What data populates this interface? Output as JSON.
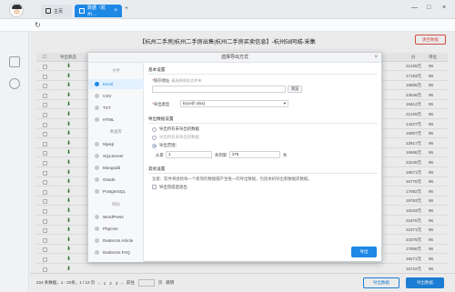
{
  "tabs": {
    "home_label": "主页",
    "active_label": "数据（杭州…",
    "add_symbol": "+",
    "close_symbol": "×"
  },
  "window": {
    "minimize": "—",
    "maximize": "□",
    "close": "×"
  },
  "page": {
    "title": "【杭州二手房|杭州二手房出售|杭州二手房买卖信息】-杭州58同城-采集",
    "delete_button": "清空数据"
  },
  "table": {
    "header_label": "导出状态",
    "header_right1": "价",
    "header_right2": "单位",
    "rows": [
      {
        "num": "21228元",
        "num2": "96"
      },
      {
        "num": "17183元",
        "num2": "96"
      },
      {
        "num": "15855元",
        "num2": "96"
      },
      {
        "num": "23548元",
        "num2": "96"
      },
      {
        "num": "16612元",
        "num2": "96"
      },
      {
        "num": "21229元",
        "num2": "96"
      },
      {
        "num": "14227元",
        "num2": "96"
      },
      {
        "num": "15807元",
        "num2": "96"
      },
      {
        "num": "22817元",
        "num2": "96"
      },
      {
        "num": "16666元",
        "num2": "96"
      },
      {
        "num": "23245元",
        "num2": "96"
      },
      {
        "num": "18571元",
        "num2": "96"
      },
      {
        "num": "16776元",
        "num2": "96"
      },
      {
        "num": "17692元",
        "num2": "96"
      },
      {
        "num": "19763元",
        "num2": "96"
      },
      {
        "num": "16233元",
        "num2": "96"
      },
      {
        "num": "21876元",
        "num2": "96"
      },
      {
        "num": "22371元",
        "num2": "96"
      },
      {
        "num": "24376元",
        "num2": "96"
      },
      {
        "num": "17856元",
        "num2": "96"
      },
      {
        "num": "19271元",
        "num2": "96"
      },
      {
        "num": "15722元",
        "num2": "96"
      }
    ]
  },
  "pager": {
    "summary": "224 条数据，1 - 22条，1 / 12 页",
    "prev": "‹",
    "p1": "1",
    "p2": "2",
    "p3": "3",
    "next": "›",
    "goto": "前往",
    "page_unit": "页",
    "jump": "跳转"
  },
  "bottom_buttons": {
    "export_note": "导出数据",
    "export_data": "导出数据"
  },
  "dialog": {
    "title": "选择导出方式",
    "close": "×",
    "side": {
      "group_file": "文件",
      "excel": "Excel",
      "csv": "CSV",
      "txt": "TXT",
      "html": "HTML",
      "group_db": "数据库",
      "mysql": "Mysql",
      "sqlserver": "SQLServer",
      "mongodb": "Mongodb",
      "oracle": "Oracle",
      "postgresql": "PostgreSQL",
      "group_site": "网站",
      "wordpress": "WordPress",
      "phpcms": "Phpcms",
      "dedecms_article": "Dedecms Article",
      "dedecms_faq": "Dedecms FAQ"
    },
    "basic_section": "基本设置",
    "save_path_label": "保存地址",
    "save_path_hint": "请选择保存文件夹",
    "browse_button": "浏览",
    "file_type_label": "导出类型",
    "file_type_value": "Excel(*.xlsx)",
    "range_section": "导出数据设置",
    "range_opt1": "导出所有未导出的数据",
    "range_opt2": "导出所有未导出的数据",
    "range_opt3": "导出范围：",
    "from_label": "从第",
    "from_value": "1",
    "to_label": "条到第",
    "to_value": "375",
    "to_unit": "条",
    "other_section": "其他设置",
    "note_text": "注意：软件将会给每一个抓到的数据都产生唯一的导出数据，包括本机导出和数据库数据。",
    "checkbox_label": "导出完成后退出",
    "confirm": "导出"
  }
}
